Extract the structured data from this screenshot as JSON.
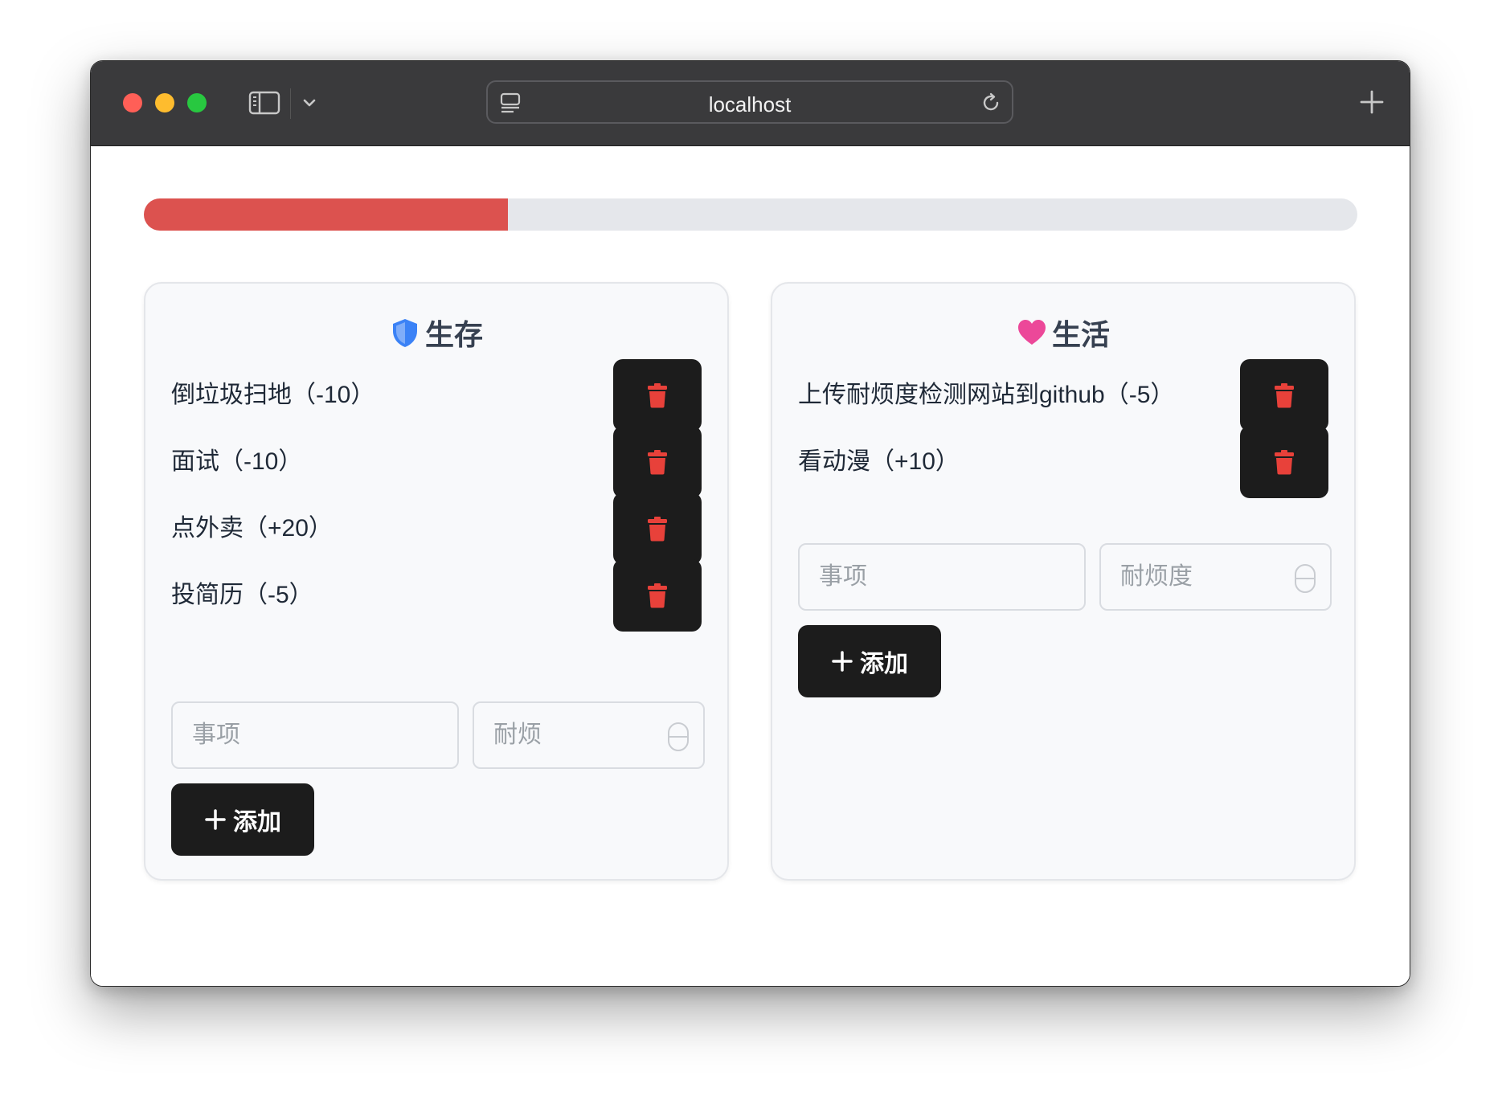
{
  "browser": {
    "url": "localhost"
  },
  "progress": {
    "fill_percent": 30,
    "color": "#dc524f"
  },
  "survival": {
    "title": "生存",
    "icon": "shield-icon",
    "items": [
      {
        "label": "倒垃圾扫地（-10）"
      },
      {
        "label": "面试（-10）"
      },
      {
        "label": "点外卖（+20）"
      },
      {
        "label": "投简历（-5）"
      }
    ],
    "item_placeholder": "事项",
    "value_placeholder": "耐烦",
    "add_label": "添加"
  },
  "life": {
    "title": "生活",
    "icon": "heart-icon",
    "items": [
      {
        "label": "上传耐烦度检测网站到github（-5）"
      },
      {
        "label": "看动漫（+10）"
      }
    ],
    "item_placeholder": "事项",
    "value_placeholder": "耐烦度",
    "add_label": "添加"
  },
  "colors": {
    "delete_icon": "#e8413a",
    "shield": "#3b82f6",
    "heart": "#ec4899"
  }
}
